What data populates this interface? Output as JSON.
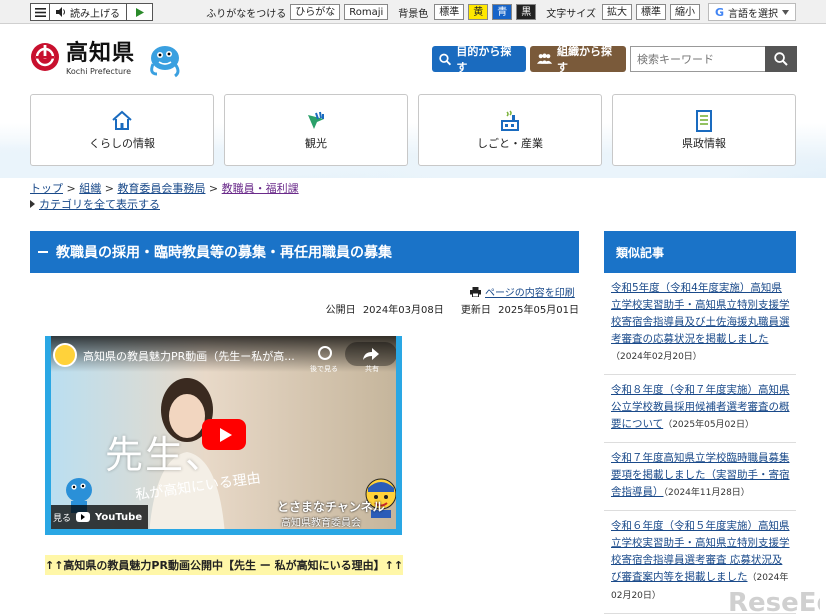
{
  "utility": {
    "read_aloud": "読み上げる",
    "furigana_label": "ふりがなをつける",
    "hiragana": "ひらがな",
    "romaji": "Romaji",
    "bg_label": "背景色",
    "bg_standard": "標準",
    "bg_yellow": "黄",
    "bg_blue": "青",
    "bg_black": "黒",
    "text_size_label": "文字サイズ",
    "text_enlarge": "拡大",
    "text_standard": "標準",
    "text_shrink": "縮小",
    "translate": "言語を選択"
  },
  "header": {
    "logo_title": "高知県",
    "logo_sub": "Kochi Prefecture",
    "purpose_button": "目的から探す",
    "org_button": "組織から探す",
    "search_placeholder": "検索キーワード"
  },
  "nav": [
    {
      "label": "くらしの情報",
      "icon": "house-icon"
    },
    {
      "label": "観光",
      "icon": "tourism-icon"
    },
    {
      "label": "しごと・産業",
      "icon": "factory-icon"
    },
    {
      "label": "県政情報",
      "icon": "document-icon"
    }
  ],
  "breadcrumb": {
    "top": "トップ",
    "org": "組織",
    "board": "教育委員会事務局",
    "current": "教職員・福利課",
    "sep": " > "
  },
  "category_link": "カテゴリを全て表示する",
  "main": {
    "title": "教職員の採用・臨時教員等の募集・再任用職員の募集",
    "print": "ページの内容を印刷",
    "published_label": "公開日",
    "published": "2024年03月08日",
    "updated_label": "更新日",
    "updated": "2025年05月01日"
  },
  "video": {
    "title": "高知県の教員魅力PR動画（先生ー私が高...",
    "watch_later": "後で見る",
    "share": "共有",
    "overlay_main": "先生、",
    "overlay_sub": "私が高知にいる理由",
    "watch_on": "見る",
    "youtube": "YouTube",
    "channel": "とさまなチャンネル",
    "channel_sub": "高知県教育委員会",
    "caption": "↑↑高知県の教員魅力PR動画公開中【先生 ー 私が高知にいる理由】↑↑"
  },
  "sidebar": {
    "title": "類似記事",
    "items": [
      {
        "text": "令和5年度（令和4年度実施）高知県立学校実習助手・高知県立特別支援学校寄宿舎指導員及び土佐海援丸職員選考審査の応募状況を掲載しました",
        "date": "（2024年02月20日）"
      },
      {
        "text": "令和８年度（令和７年度実施）高知県公立学校教員採用候補者選考審査の概要について",
        "date": "（2025年05月02日）"
      },
      {
        "text": "令和７年度高知県立学校臨時職員募集要項を掲載しました（実習助手・寄宿舎指導員）",
        "date": "（2024年11月28日）"
      },
      {
        "text": "令和６年度（令和５年度実施）高知県立学校実習助手・高知県立特別支援学校寄宿舎指導員選考審査 応募状況及び審査案内等を掲載しました",
        "date": "（2024年02月20日）"
      }
    ]
  },
  "colors": {
    "accent": "#1a73c8",
    "org_button": "#7a5a3a",
    "caption_bg": "#fff7a8"
  }
}
